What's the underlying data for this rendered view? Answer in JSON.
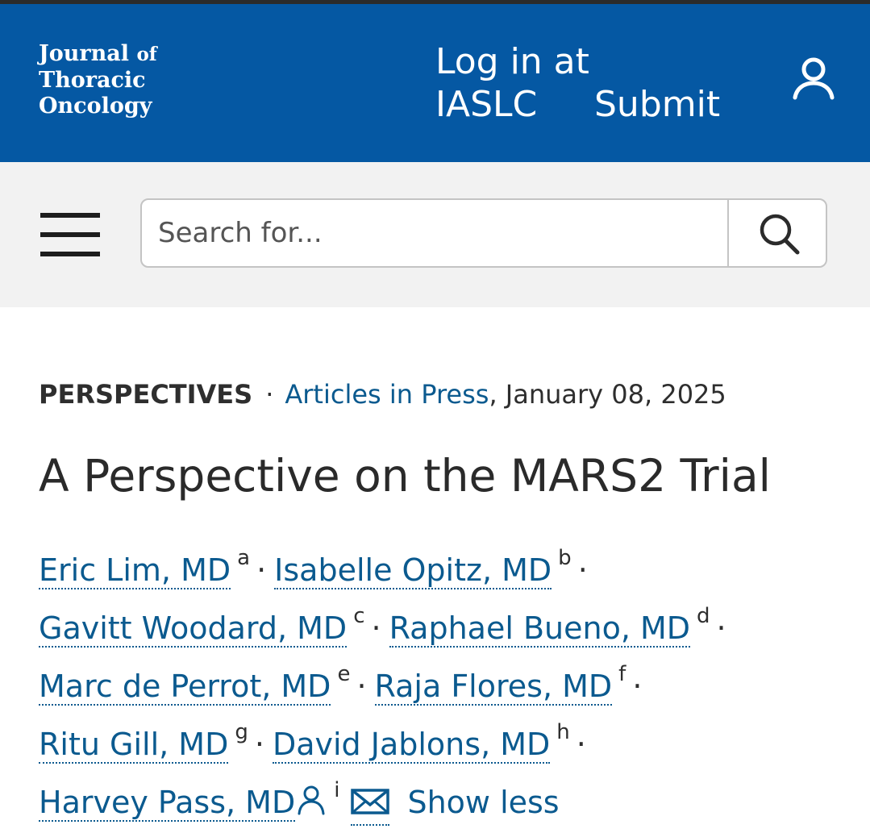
{
  "header": {
    "logo_line1": "Journal",
    "logo_of": "of",
    "logo_line2": "Thoracic",
    "logo_line3": "Oncology",
    "login_label": "Log in at IASLC",
    "submit_label": "Submit",
    "user_icon": "user-icon",
    "background_color": "#0558a3"
  },
  "search": {
    "menu_icon": "hamburger-menu-icon",
    "placeholder": "Search for...",
    "search_icon": "search-icon"
  },
  "article": {
    "kind": "PERSPECTIVES",
    "separator": "·",
    "issue": "Articles in Press",
    "date": ", January 08, 2025",
    "title": "A Perspective on the MARS2 Trial",
    "authors": [
      {
        "name": "Eric Lim, MD",
        "affil": "a"
      },
      {
        "name": "Isabelle Opitz, MD",
        "affil": "b"
      },
      {
        "name": "Gavitt Woodard, MD",
        "affil": "c"
      },
      {
        "name": "Raphael Bueno, MD",
        "affil": "d"
      },
      {
        "name": "Marc de Perrot, MD",
        "affil": "e"
      },
      {
        "name": "Raja Flores, MD",
        "affil": "f"
      },
      {
        "name": "Ritu Gill, MD",
        "affil": "g"
      },
      {
        "name": "David Jablons, MD",
        "affil": "h"
      },
      {
        "name": "Harvey Pass, MD",
        "affil": "i"
      }
    ],
    "author_separator": "·",
    "corresponding_icon": "person-icon",
    "email_icon": "envelope-icon",
    "show_less_label": "Show less"
  }
}
